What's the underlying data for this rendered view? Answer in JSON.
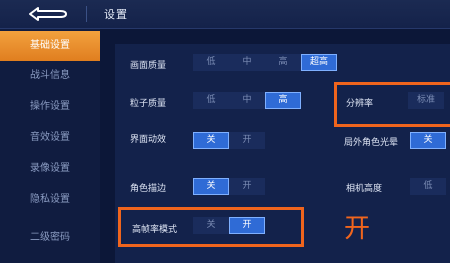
{
  "header": {
    "title": "设置"
  },
  "sidebar": {
    "items": [
      {
        "label": "基础设置",
        "active": true
      },
      {
        "label": "战斗信息",
        "active": false
      },
      {
        "label": "操作设置",
        "active": false
      },
      {
        "label": "音效设置",
        "active": false
      },
      {
        "label": "录像设置",
        "active": false
      },
      {
        "label": "隐私设置",
        "active": false
      },
      {
        "label": "二级密码",
        "active": false
      }
    ]
  },
  "settings": {
    "picture_quality": {
      "label": "画面质量",
      "options": [
        "低",
        "中",
        "高",
        "超高"
      ],
      "selected": "超高"
    },
    "particle_quality": {
      "label": "粒子质量",
      "options": [
        "低",
        "中",
        "高"
      ],
      "selected": "高"
    },
    "ui_animation": {
      "label": "界面动效",
      "options": [
        "关",
        "开"
      ],
      "selected": "关"
    },
    "character_outline": {
      "label": "角色描边",
      "options": [
        "关",
        "开"
      ],
      "selected": "关"
    },
    "high_frame_rate": {
      "label": "高帧率模式",
      "options": [
        "关",
        "开"
      ],
      "selected": "开"
    },
    "resolution": {
      "label": "分辨率",
      "options": [
        "标准"
      ],
      "selected": null
    },
    "out_of_game_halo": {
      "label": "局外角色光晕",
      "options": [
        "关"
      ],
      "selected": "关"
    },
    "camera_height": {
      "label": "相机高度",
      "options": [
        "低"
      ],
      "selected": null
    }
  },
  "annotation": {
    "text": "开",
    "color": "#f0651d"
  },
  "colors": {
    "accent_orange": "#f0651d",
    "active_tab": "#e8902c",
    "selected_blue": "#2f6bd6",
    "background": "#0c1738"
  }
}
